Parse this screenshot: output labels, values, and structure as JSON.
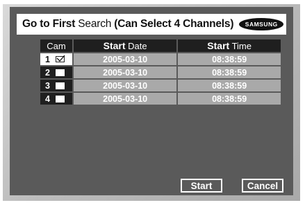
{
  "dialog": {
    "title_bold_prefix": "Go to First",
    "title_light": "Search",
    "title_suffix": "(Can Select 4 Channels)",
    "logo_text": "SAMSUNG"
  },
  "table": {
    "headers": {
      "cam": "Cam",
      "start_date_bold": "Start",
      "start_date_light": "Date",
      "start_time_bold": "Start",
      "start_time_light": "Time"
    },
    "rows": [
      {
        "cam": "1",
        "checked": true,
        "date": "2005-03-10",
        "time": "08:38:59"
      },
      {
        "cam": "2",
        "checked": false,
        "date": "2005-03-10",
        "time": "08:38:59"
      },
      {
        "cam": "3",
        "checked": false,
        "date": "2005-03-10",
        "time": "08:38:59"
      },
      {
        "cam": "4",
        "checked": false,
        "date": "2005-03-10",
        "time": "08:38:59"
      }
    ]
  },
  "buttons": {
    "start": "Start",
    "cancel": "Cancel"
  },
  "colors": {
    "dialog_bg": "#5a5a5a",
    "header_bg": "#1f1f1f",
    "row_bg": "#a9a9a9"
  }
}
